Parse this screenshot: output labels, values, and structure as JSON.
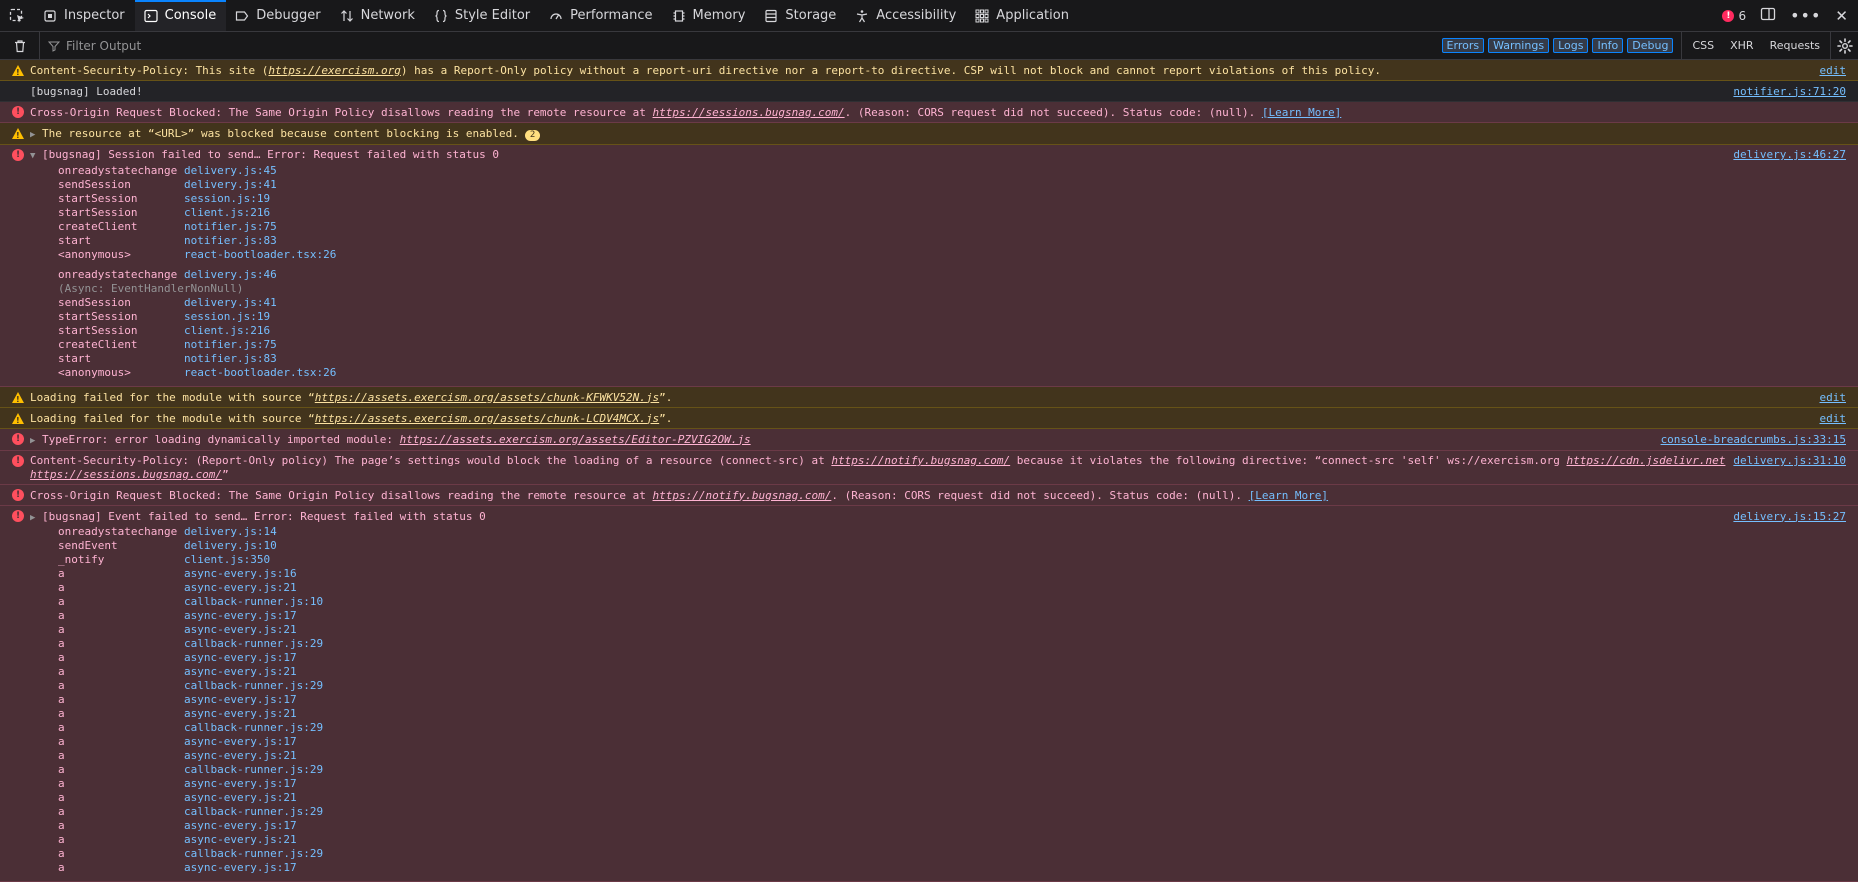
{
  "toolbar": {
    "tabs": [
      {
        "label": "Inspector",
        "icon": "inspector-icon"
      },
      {
        "label": "Console",
        "icon": "console-icon",
        "selected": true
      },
      {
        "label": "Debugger",
        "icon": "debugger-icon"
      },
      {
        "label": "Network",
        "icon": "network-icon"
      },
      {
        "label": "Style Editor",
        "icon": "style-editor-icon"
      },
      {
        "label": "Performance",
        "icon": "performance-icon"
      },
      {
        "label": "Memory",
        "icon": "memory-icon"
      },
      {
        "label": "Storage",
        "icon": "storage-icon"
      },
      {
        "label": "Accessibility",
        "icon": "accessibility-icon"
      },
      {
        "label": "Application",
        "icon": "application-icon"
      }
    ],
    "error_count": "6"
  },
  "filter": {
    "placeholder": "Filter Output",
    "levels": [
      "Errors",
      "Warnings",
      "Logs",
      "Info",
      "Debug"
    ],
    "net": [
      "CSS",
      "XHR",
      "Requests"
    ]
  },
  "messages": {
    "m1": {
      "pre": "Content-Security-Policy: This site (",
      "link": "https://exercism.org",
      "post": ") has a Report-Only policy without a report-uri directive nor a report-to directive. CSP will not block and cannot report violations of this policy.",
      "loc": "edit"
    },
    "m2": {
      "text": "[bugsnag] Loaded!",
      "loc": "notifier.js:71:20"
    },
    "m3": {
      "pre": "Cross-Origin Request Blocked: The Same Origin Policy disallows reading the remote resource at ",
      "link": "https://sessions.bugsnag.com/",
      "post": ". (Reason: CORS request did not succeed). Status code: (null). ",
      "learn": "[Learn More]"
    },
    "m4": {
      "text": "The resource at “<URL>” was blocked because content blocking is enabled.",
      "badge": "2"
    },
    "m5": {
      "text": "[bugsnag] Session failed to send… Error: Request failed with status 0",
      "loc": "delivery.js:46:27",
      "stack1": [
        [
          "onreadystatechange",
          "delivery.js:45"
        ],
        [
          "sendSession",
          "delivery.js:41"
        ],
        [
          "startSession",
          "session.js:19"
        ],
        [
          "startSession",
          "client.js:216"
        ],
        [
          "createClient",
          "notifier.js:75"
        ],
        [
          "start",
          "notifier.js:83"
        ],
        [
          "<anonymous>",
          "react-bootloader.tsx:26"
        ]
      ],
      "stack2_first": [
        "onreadystatechange",
        "delivery.js:46"
      ],
      "async": "(Async: EventHandlerNonNull)",
      "stack2": [
        [
          "sendSession",
          "delivery.js:41"
        ],
        [
          "startSession",
          "session.js:19"
        ],
        [
          "startSession",
          "client.js:216"
        ],
        [
          "createClient",
          "notifier.js:75"
        ],
        [
          "start",
          "notifier.js:83"
        ],
        [
          "<anonymous>",
          "react-bootloader.tsx:26"
        ]
      ]
    },
    "m6": {
      "pre": "Loading failed for the module with source “",
      "link": "https://assets.exercism.org/assets/chunk-KFWKV52N.js",
      "post": "”.",
      "loc": "edit"
    },
    "m7": {
      "pre": "Loading failed for the module with source “",
      "link": "https://assets.exercism.org/assets/chunk-LCDV4MCX.js",
      "post": "”.",
      "loc": "edit"
    },
    "m8": {
      "pre": "TypeError: error loading dynamically imported module: ",
      "link": "https://assets.exercism.org/assets/Editor-PZVIG2OW.js",
      "loc": "console-breadcrumbs.js:33:15"
    },
    "m9": {
      "pre": "Content-Security-Policy: (Report-Only policy) The page’s settings would block the loading of a resource (connect-src) at ",
      "link": "https://notify.bugsnag.com/",
      "mid": " because it violates the following directive: “connect-src 'self' ws://exercism.org ",
      "link2": "https://cdn.jsdelivr.net",
      "link3": "https://sessions.bugsnag.com/",
      "post": "”",
      "loc": "delivery.js:31:10"
    },
    "m10": {
      "pre": "Cross-Origin Request Blocked: The Same Origin Policy disallows reading the remote resource at ",
      "link": "https://notify.bugsnag.com/",
      "post": ". (Reason: CORS request did not succeed). Status code: (null). ",
      "learn": "[Learn More]"
    },
    "m11": {
      "text": "[bugsnag] Event failed to send… Error: Request failed with status 0",
      "loc": "delivery.js:15:27",
      "stack": [
        [
          "onreadystatechange",
          "delivery.js:14"
        ],
        [
          "sendEvent",
          "delivery.js:10"
        ],
        [
          "_notify",
          "client.js:350"
        ],
        [
          "a",
          "async-every.js:16"
        ],
        [
          "a",
          "async-every.js:21"
        ],
        [
          "a",
          "callback-runner.js:10"
        ],
        [
          "a",
          "async-every.js:17"
        ],
        [
          "a",
          "async-every.js:21"
        ],
        [
          "a",
          "callback-runner.js:29"
        ],
        [
          "a",
          "async-every.js:17"
        ],
        [
          "a",
          "async-every.js:21"
        ],
        [
          "a",
          "callback-runner.js:29"
        ],
        [
          "a",
          "async-every.js:17"
        ],
        [
          "a",
          "async-every.js:21"
        ],
        [
          "a",
          "callback-runner.js:29"
        ],
        [
          "a",
          "async-every.js:17"
        ],
        [
          "a",
          "async-every.js:21"
        ],
        [
          "a",
          "callback-runner.js:29"
        ],
        [
          "a",
          "async-every.js:17"
        ],
        [
          "a",
          "async-every.js:21"
        ],
        [
          "a",
          "callback-runner.js:29"
        ],
        [
          "a",
          "async-every.js:17"
        ],
        [
          "a",
          "async-every.js:21"
        ],
        [
          "a",
          "callback-runner.js:29"
        ],
        [
          "a",
          "async-every.js:17"
        ]
      ]
    }
  }
}
